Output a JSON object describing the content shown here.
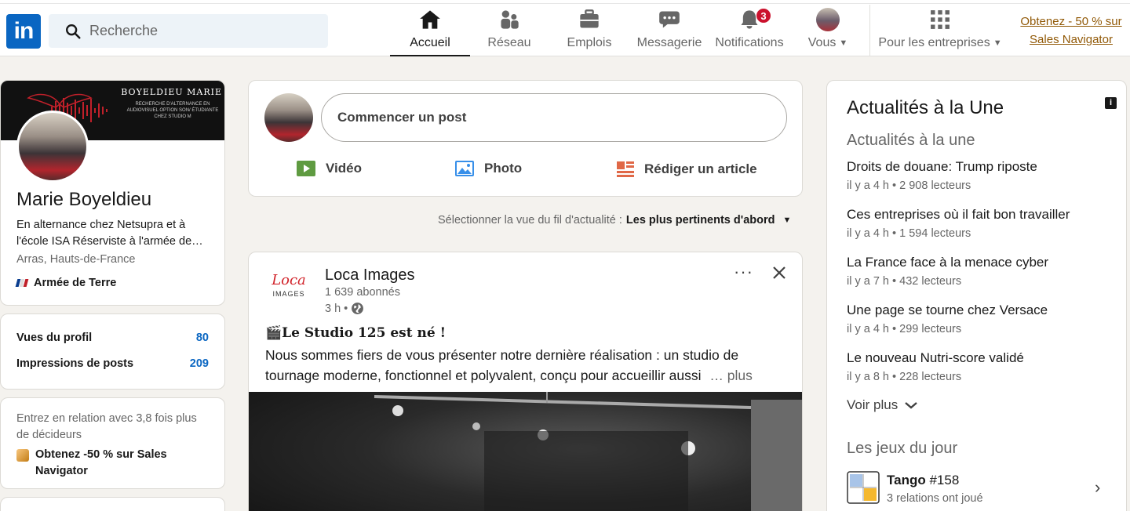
{
  "header": {
    "logo_text": "in",
    "search_placeholder": "Recherche",
    "nav": [
      {
        "label": "Accueil",
        "icon": "home-icon",
        "active": true
      },
      {
        "label": "Réseau",
        "icon": "network-icon"
      },
      {
        "label": "Emplois",
        "icon": "briefcase-icon"
      },
      {
        "label": "Messagerie",
        "icon": "message-icon"
      },
      {
        "label": "Notifications",
        "icon": "bell-icon",
        "badge": "3"
      },
      {
        "label": "Vous",
        "icon": "avatar"
      },
      {
        "label": "Pour les entreprises",
        "icon": "grid-icon"
      }
    ],
    "promo_line1": "Obtenez - 50 % sur",
    "promo_line2": "Sales Navigator"
  },
  "profile": {
    "banner_title": "BOYELDIEU MARIE",
    "banner_sub": "RECHERCHE D'ALTERNANCE EN AUDIOVISUEL OPTION SON/ ÉTUDIANTE CHEZ STUDIO M",
    "name": "Marie Boyeldieu",
    "headline": "En alternance chez Netsupra et à l'école ISA Réserviste à l'armée de…",
    "location": "Arras, Hauts-de-France",
    "org": "Armée de Terre"
  },
  "stats": {
    "views_label": "Vues du profil",
    "views_value": "80",
    "impr_label": "Impressions de posts",
    "impr_value": "209"
  },
  "premium": {
    "text": "Entrez en relation avec 3,8 fois plus de décideurs",
    "cta": "Obtenez -50 % sur Sales Navigator"
  },
  "composer": {
    "placeholder": "Commencer un post",
    "video": "Vidéo",
    "photo": "Photo",
    "article": "Rédiger un article"
  },
  "feed_sort": {
    "label": "Sélectionner la vue du fil d'actualité :",
    "value": "Les plus pertinents d'abord"
  },
  "post": {
    "author": "Loca Images",
    "followers": "1 639 abonnés",
    "time": "3 h •",
    "logo_text_top": "Loca",
    "logo_text_bottom": "IMAGES",
    "title": "🎬𝐋𝐞 𝐒𝐭𝐮𝐝𝐢𝐨 𝟏𝟐𝟓 𝐞𝐬𝐭 𝐧𝐞́ !",
    "body": "Nous sommes fiers de vous présenter notre dernière réalisation : un studio de tournage moderne, fonctionnel et polyvalent, conçu pour accueillir aussi",
    "more": "… plus"
  },
  "news": {
    "title": "Actualités à la Une",
    "subtitle": "Actualités à la une",
    "items": [
      {
        "title": "Droits de douane: Trump riposte",
        "meta": "il y a 4 h • 2 908 lecteurs"
      },
      {
        "title": "Ces entreprises où il fait bon travailler",
        "meta": "il y a 4 h • 1 594 lecteurs"
      },
      {
        "title": "La France face à la menace cyber",
        "meta": "il y a 7 h • 432 lecteurs"
      },
      {
        "title": "Une page se tourne chez Versace",
        "meta": "il y a 4 h • 299 lecteurs"
      },
      {
        "title": "Le nouveau Nutri-score validé",
        "meta": "il y a 8 h • 228 lecteurs"
      }
    ],
    "more": "Voir plus",
    "games_title": "Les jeux du jour",
    "game_name": "Tango",
    "game_num": "#158",
    "game_meta": "3 relations ont joué"
  }
}
